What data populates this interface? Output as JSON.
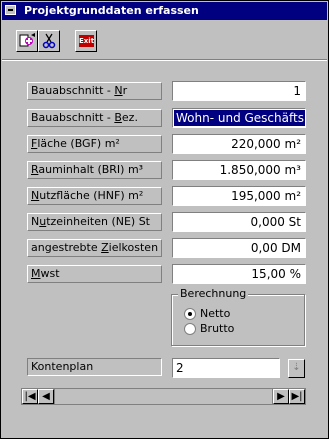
{
  "window": {
    "title": "Projektgrunddaten erfassen"
  },
  "toolbar": {
    "buttons": [
      {
        "name": "add-record-icon"
      },
      {
        "name": "cut-icon"
      },
      {
        "name": "exit-icon",
        "label": "Exit"
      }
    ]
  },
  "fields": [
    {
      "label_u": "",
      "label_rest_pre": "Bauabschnitt - ",
      "label_u2": "N",
      "label_rest": "r",
      "value": "1"
    },
    {
      "label_u": "",
      "label_rest_pre": "Bauabschnitt - ",
      "label_u2": "B",
      "label_rest": "ez.",
      "value": "Wohn- und Geschäftsh"
    },
    {
      "label_u": "F",
      "label_rest_pre": "",
      "label_u2": "",
      "label_rest": "läche (BGF) m²",
      "value": "220,000 m²"
    },
    {
      "label_u": "R",
      "label_rest_pre": "",
      "label_u2": "",
      "label_rest": "auminhalt (BRI) m³",
      "value": "1.850,000 m³"
    },
    {
      "label_u": "N",
      "label_rest_pre": "",
      "label_u2": "",
      "label_rest": "utzfläche (HNF) m²",
      "value": "195,000 m²"
    },
    {
      "label_u": "",
      "label_rest_pre": "N",
      "label_u2": "u",
      "label_rest": "tzeinheiten (NE) St",
      "value": "0,000 St"
    },
    {
      "label_u": "",
      "label_rest_pre": "angestrebte ",
      "label_u2": "Z",
      "label_rest": "ielkosten",
      "value": "0,00 DM"
    },
    {
      "label_u": "M",
      "label_rest_pre": "",
      "label_u2": "",
      "label_rest": "wst",
      "value": "15,00 %"
    }
  ],
  "berechnung": {
    "title": "Berechnung",
    "options": [
      {
        "label": "Netto",
        "checked": true
      },
      {
        "label": "Brutto",
        "checked": false
      }
    ]
  },
  "kontenplan": {
    "label": "Kontenplan",
    "value": "2"
  },
  "navigator": {
    "first": "|◀",
    "prev": "◀",
    "next": "▶",
    "last": "▶|"
  }
}
